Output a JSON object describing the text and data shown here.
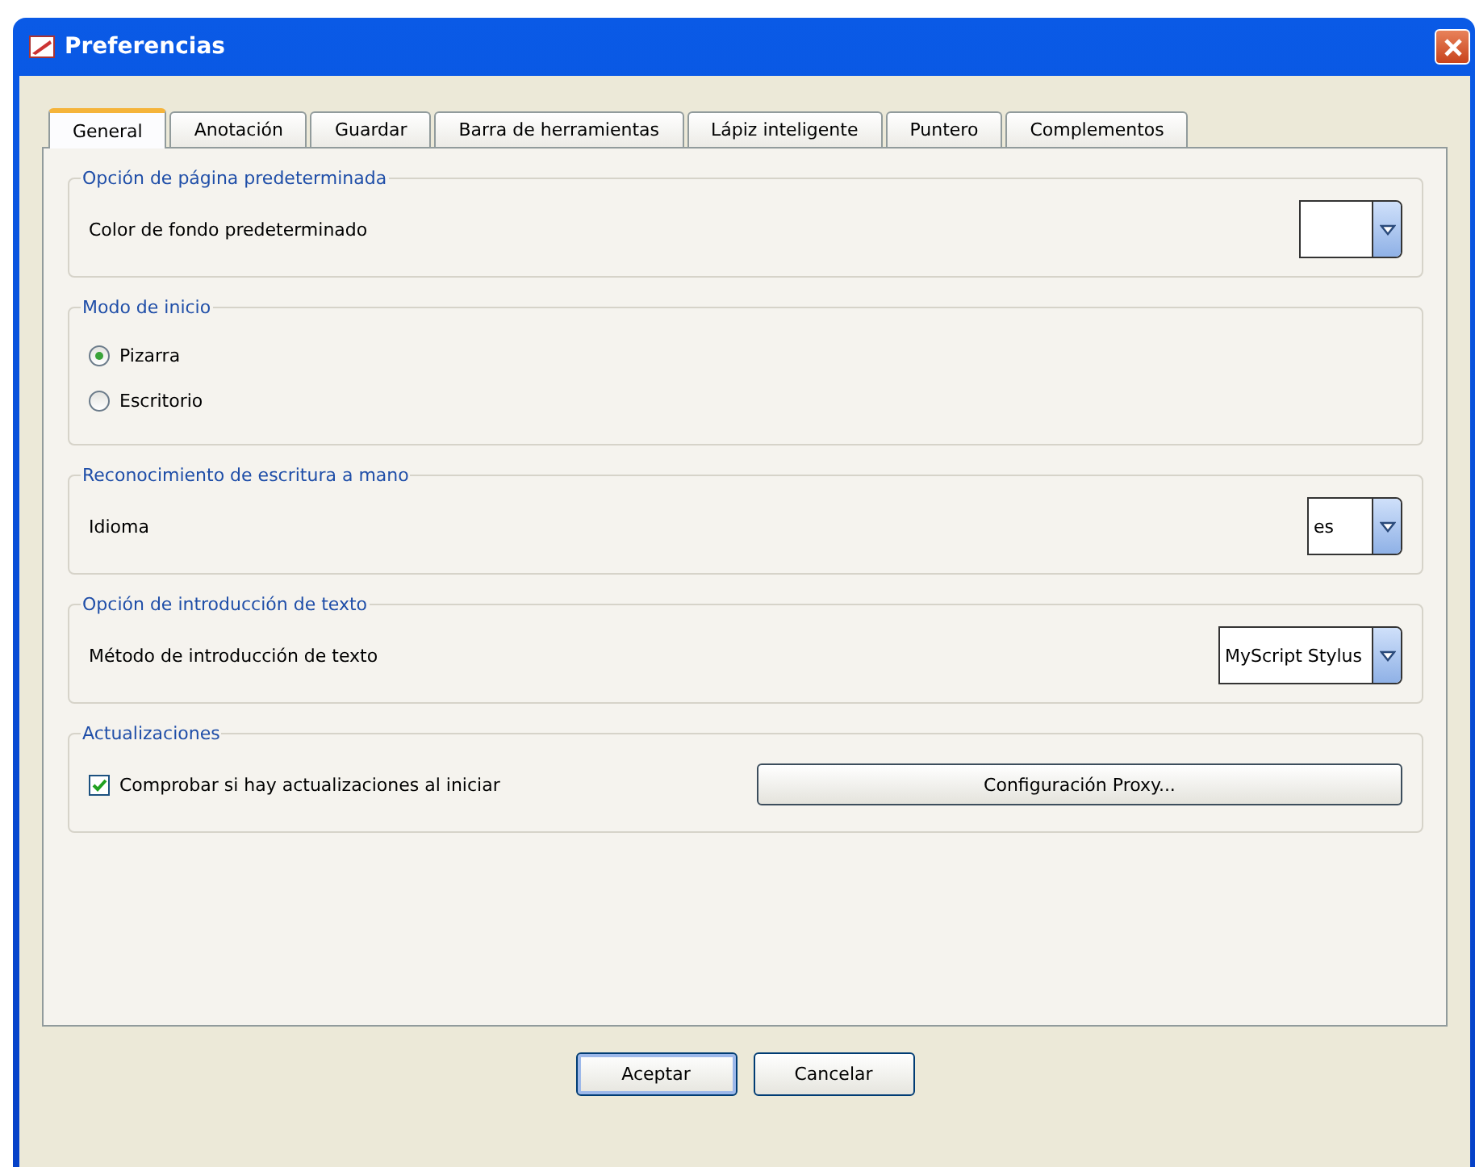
{
  "window": {
    "title": "Preferencias"
  },
  "tabs": [
    {
      "label": "General",
      "selected": true
    },
    {
      "label": "Anotación",
      "selected": false
    },
    {
      "label": "Guardar",
      "selected": false
    },
    {
      "label": "Barra de herramientas",
      "selected": false
    },
    {
      "label": "Lápiz inteligente",
      "selected": false
    },
    {
      "label": "Puntero",
      "selected": false
    },
    {
      "label": "Complementos",
      "selected": false
    }
  ],
  "groups": [
    {
      "kind": "dropdown",
      "title": "Opción de página predeterminada",
      "label": "Color de fondo predeterminado"
    },
    {
      "kind": "radios",
      "title": "Modo de inicio",
      "options": [
        {
          "label": "Pizarra",
          "selected": true
        },
        {
          "label": "Escritorio",
          "selected": false
        }
      ]
    },
    {
      "kind": "dropdown",
      "title": "Reconocimiento de escritura a mano",
      "label": "Idioma",
      "value": "es"
    },
    {
      "kind": "dropdown",
      "title": "Opción de introducción de texto",
      "label": "Método de introducción de texto",
      "value": "MyScript Stylus"
    },
    {
      "kind": "checkbox",
      "title": "Actualizaciones",
      "label": "Comprobar si hay actualizaciones al iniciar",
      "checked": true,
      "button": "Configuración Proxy..."
    }
  ],
  "buttons": [
    "Aceptar",
    "Cancelar"
  ]
}
